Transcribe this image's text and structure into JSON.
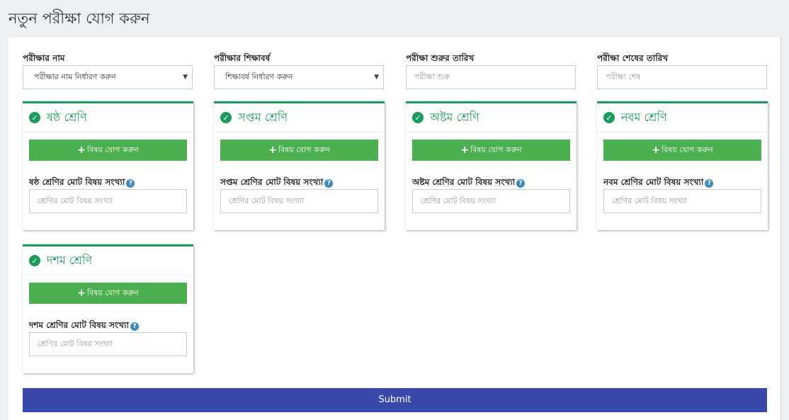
{
  "page_title": "নতুন পরীক্ষা যোগ করুন",
  "fields": [
    {
      "label": "পরীক্ষার নাম",
      "value": "পরীক্ষার নাম নির্ধারণ করুন",
      "type": "select"
    },
    {
      "label": "পরীক্ষার শিক্ষাবর্ষ",
      "value": "শিক্ষাবর্ষ নির্ধারণ করুন",
      "type": "select"
    },
    {
      "label": "পরীক্ষা শুরুর তারিখ",
      "placeholder": "পরীক্ষা শুরু",
      "type": "date"
    },
    {
      "label": "পরীক্ষা শেষের তারিখ",
      "placeholder": "পরীক্ষা শেষ",
      "type": "date"
    }
  ],
  "classes": [
    {
      "title": "ষষ্ঠ শ্রেণি",
      "count_label": "ষষ্ঠ শ্রেণির মোট বিষয় সংখ্যা"
    },
    {
      "title": "সপ্তম শ্রেণি",
      "count_label": "সপ্তম শ্রেণির মোট বিষয় সংখ্যা"
    },
    {
      "title": "অষ্টম শ্রেণি",
      "count_label": "অষ্টম শ্রেণির মোট বিষয় সংখ্যা"
    },
    {
      "title": "নবম শ্রেণি",
      "count_label": "নবম শ্রেণির মোট বিষয় সংখ্যা"
    },
    {
      "title": "দশম শ্রেণি",
      "count_label": "দশম শ্রেণির মোট বিষয় সংখ্যা"
    }
  ],
  "add_subject_label": "বিষয় যোগ করুন",
  "count_placeholder": "শ্রেণির মোট বিষয় সংখ্যা",
  "submit_label": "Submit",
  "colors": {
    "accent": "#1a9a5c",
    "add_button": "#4caf50",
    "submit": "#3949ab"
  }
}
